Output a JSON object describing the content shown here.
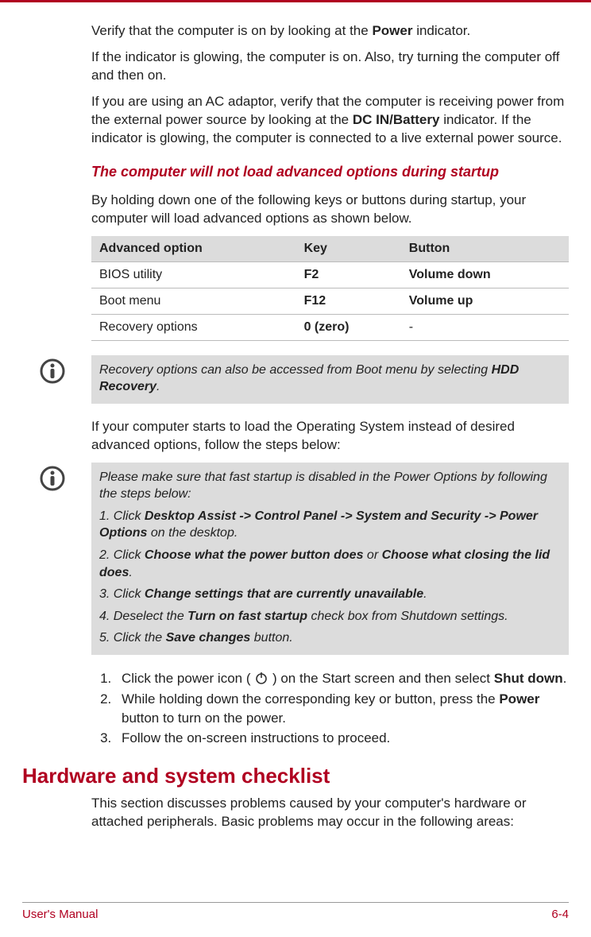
{
  "paragraphs": {
    "p1_before": "Verify that the computer is on by looking at the ",
    "p1_bold1": "Power",
    "p1_after": " indicator.",
    "p2": "If the indicator is glowing, the computer is on. Also, try turning the computer off and then on.",
    "p3_a": "If you are using an AC adaptor, verify that the computer is receiving power from the external power source by looking at the ",
    "p3_bold": "DC IN/Battery",
    "p3_b": " indicator. If the indicator is glowing, the computer is connected to a live external power source."
  },
  "heading1": "The computer will not load advanced options during startup",
  "p4": "By holding down one of the following keys or buttons during startup, your computer will load advanced options as shown below.",
  "table": {
    "headers": [
      "Advanced option",
      "Key",
      "Button"
    ],
    "rows": [
      {
        "opt": "BIOS utility",
        "key": "F2",
        "btn": "Volume down"
      },
      {
        "opt": "Boot menu",
        "key": "F12",
        "btn": "Volume up"
      },
      {
        "opt": "Recovery options",
        "key": "0 (zero)",
        "btn": "-"
      }
    ]
  },
  "note1": {
    "text_a": "Recovery options can also be accessed from Boot menu by selecting ",
    "text_bold": "HDD Recovery",
    "text_b": "."
  },
  "p5": "If your computer starts to load the Operating System instead of desired advanced options, follow the steps below:",
  "note2": {
    "line1": "Please make sure that fast startup is disabled in the Power Options by following the steps below:",
    "step1_a": "1. Click ",
    "step1_bold": "Desktop Assist -> Control Panel -> System and Security -> Power Options",
    "step1_b": " on the desktop.",
    "step2_a": "2. Click ",
    "step2_bold1": "Choose what the power button does",
    "step2_mid": " or ",
    "step2_bold2": "Choose what closing the lid does",
    "step2_b": ".",
    "step3_a": "3. Click ",
    "step3_bold": "Change settings that are currently unavailable",
    "step3_b": ".",
    "step4_a": "4. Deselect the ",
    "step4_bold": "Turn on fast startup",
    "step4_b": " check box from Shutdown settings.",
    "step5_a": "5. Click the ",
    "step5_bold": "Save changes",
    "step5_b": " button."
  },
  "steps": {
    "s1_a": "Click the power icon ( ",
    "s1_b": " ) on the Start screen and then select ",
    "s1_bold": "Shut down",
    "s1_c": ".",
    "s2_a": "While holding down the corresponding key or button, press the ",
    "s2_bold": "Power",
    "s2_b": " button to turn on the power.",
    "s3": "Follow the on-screen instructions to proceed."
  },
  "h1": "Hardware and system checklist",
  "p6": "This section discusses problems caused by your computer's hardware or attached peripherals. Basic problems may occur in the following areas:",
  "footer": {
    "left": "User's Manual",
    "right": "6-4"
  }
}
